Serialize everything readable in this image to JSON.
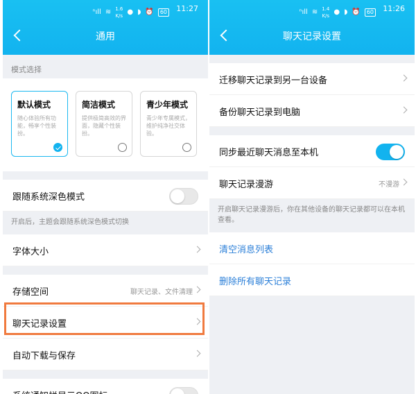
{
  "left": {
    "status": {
      "net_speed": "1.6\nK/s",
      "battery": "60",
      "time": "11:27"
    },
    "title": "通用",
    "mode_section_caption": "模式选择",
    "modes": [
      {
        "title": "默认模式",
        "desc": "随心体验所有功能，畅享个性装扮。",
        "selected": true
      },
      {
        "title": "简洁模式",
        "desc": "提供极简高效的界面，隐藏个性装扮。",
        "selected": false
      },
      {
        "title": "青少年模式",
        "desc": "青少年专属模式，维护纯净社交体验。",
        "selected": false
      }
    ],
    "dark_mode_label": "跟随系统深色模式",
    "dark_mode_note": "开启后，主题会跟随系统深色模式切换",
    "font_size_label": "字体大小",
    "storage_label": "存储空间",
    "storage_value": "聊天记录、文件清理",
    "chat_settings_label": "聊天记录设置",
    "auto_download_label": "自动下载与保存",
    "notify_icon_label": "系统通知栏显示QQ图标"
  },
  "right": {
    "status": {
      "net_speed": "1.4\nK/s",
      "battery": "60",
      "time": "11:26"
    },
    "title": "聊天记录设置",
    "migrate_label": "迁移聊天记录到另一台设备",
    "backup_label": "备份聊天记录到电脑",
    "sync_label": "同步最近聊天消息至本机",
    "sync_on": true,
    "roaming_label": "聊天记录漫游",
    "roaming_value": "不漫游",
    "roaming_note": "开启聊天记录漫游后，你在其他设备的聊天记录都可以在本机查看。",
    "clear_list_label": "清空消息列表",
    "delete_all_label": "删除所有聊天记录"
  },
  "colors": {
    "accent": "#12b3ef",
    "highlight": "#f07a3e",
    "link": "#2b7fd8"
  }
}
